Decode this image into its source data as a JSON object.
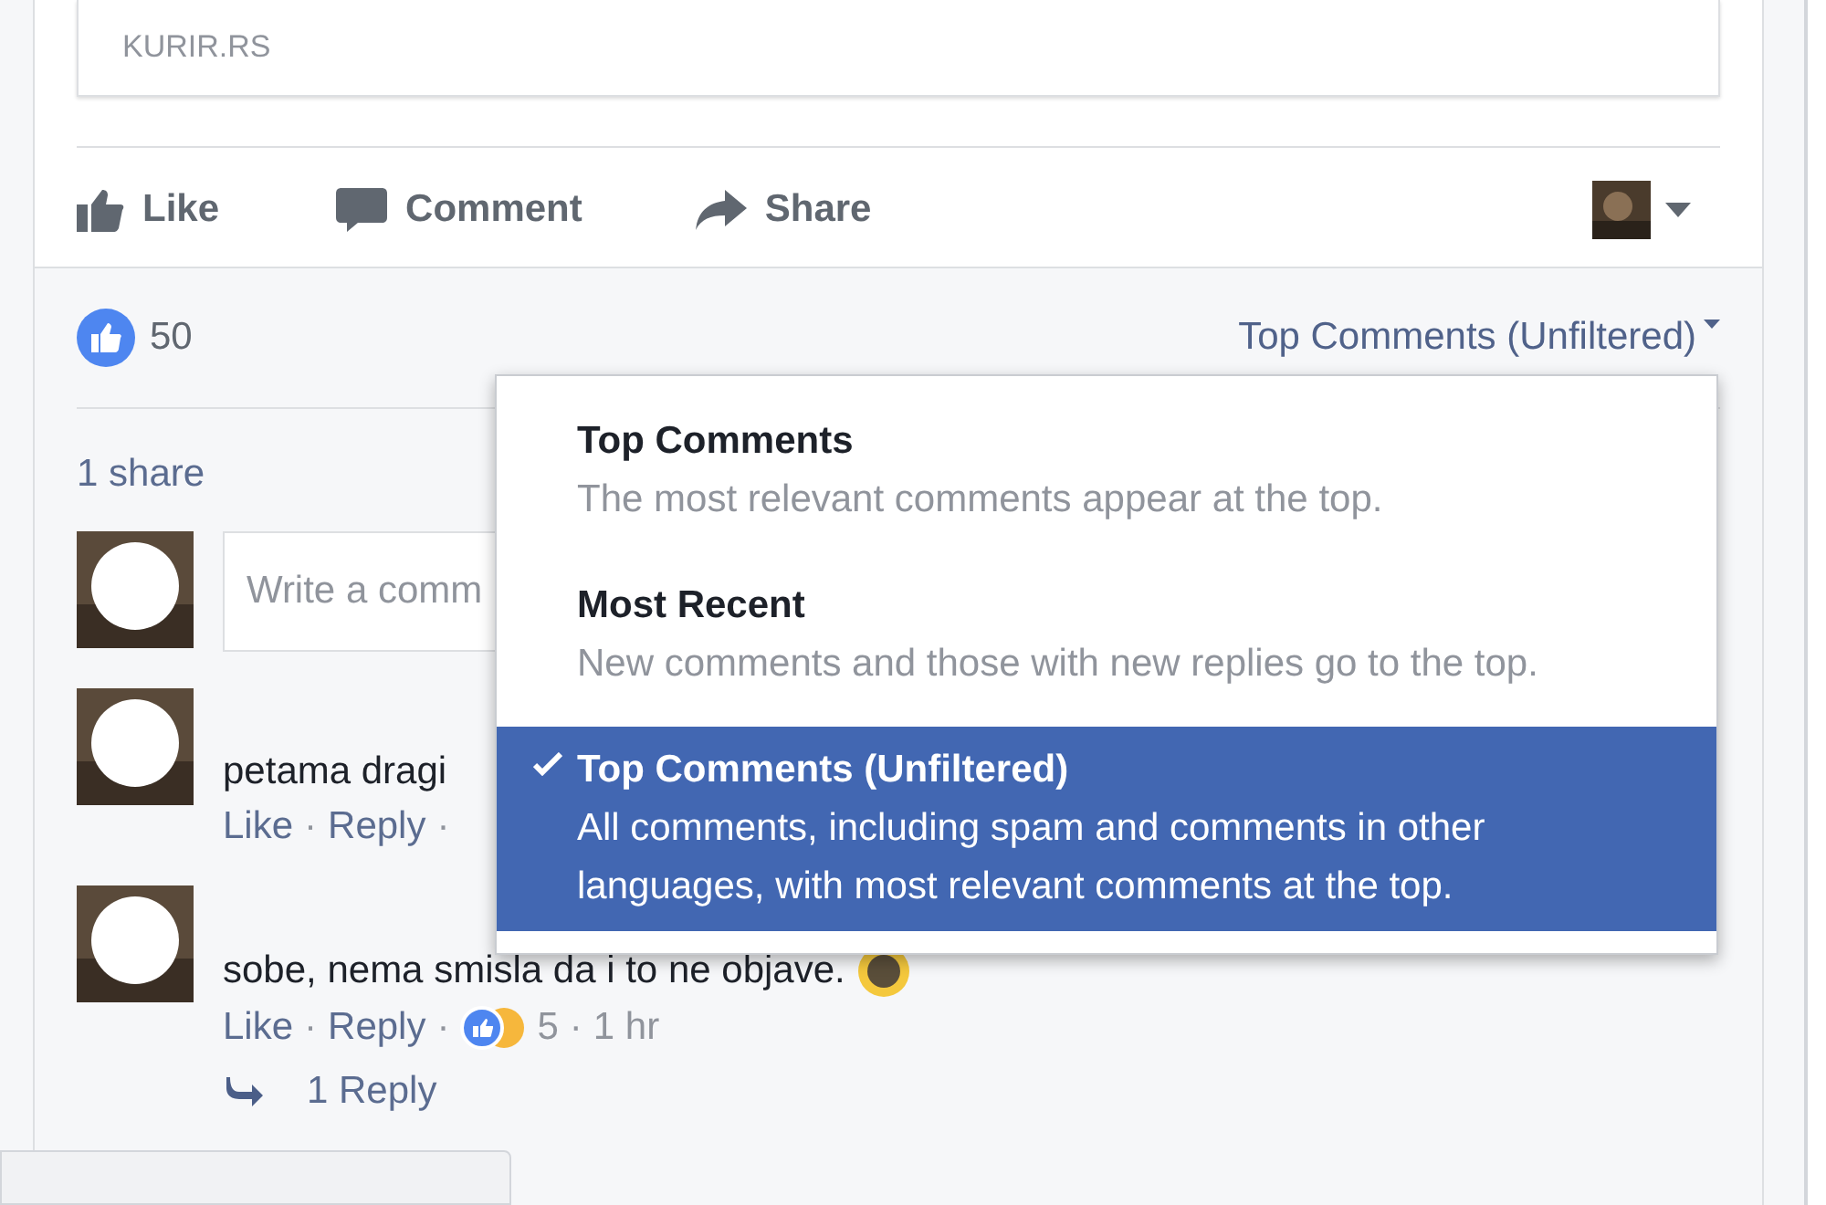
{
  "link_preview": {
    "domain": "KURIR.RS"
  },
  "actions": [
    {
      "kind": "like",
      "label": "Like"
    },
    {
      "kind": "comment",
      "label": "Comment"
    },
    {
      "kind": "share",
      "label": "Share"
    }
  ],
  "reactions": {
    "count": "50"
  },
  "sort_menu": {
    "label": "Top Comments (Unfiltered)",
    "options": [
      {
        "title": "Top Comments",
        "description": "The most relevant comments appear at the top.",
        "selected": false
      },
      {
        "title": "Most Recent",
        "description": "New comments and those with new replies go to the top.",
        "selected": false
      },
      {
        "title": "Top Comments (Unfiltered)",
        "description": "All comments, including spam and comments in other languages, with most relevant comments at the top.",
        "selected": true
      }
    ]
  },
  "shares": "1 share",
  "composer": {
    "placeholder": "Write a comm"
  },
  "separator": "·",
  "comments": [
    {
      "text": "petama dragi",
      "actions": [
        "Like",
        "Reply"
      ],
      "emoji": false
    },
    {
      "text": "sobe, nema smisla da i to ne objave.",
      "actions": [
        "Like",
        "Reply"
      ],
      "reaction_count": "5",
      "time": "1 hr",
      "emoji": true,
      "replies": "1 Reply"
    }
  ]
}
